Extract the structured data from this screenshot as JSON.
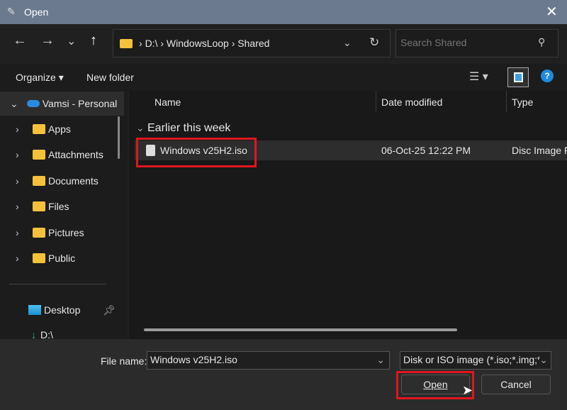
{
  "window": {
    "title": "Open",
    "close": "✕"
  },
  "nav": {
    "back": "←",
    "forward": "→",
    "recent": "⌄",
    "up": "↑"
  },
  "address": {
    "parts": [
      "D:\\",
      "WindowsLoop",
      "Shared"
    ]
  },
  "search": {
    "placeholder": "Search Shared"
  },
  "toolbar": {
    "organize": "Organize ▾",
    "new_folder": "New folder",
    "help": "?"
  },
  "sidebar": {
    "root": "Vamsi - Personal",
    "items": [
      {
        "label": "Apps"
      },
      {
        "label": "Attachments"
      },
      {
        "label": "Documents"
      },
      {
        "label": "Files"
      },
      {
        "label": "Pictures"
      },
      {
        "label": "Public"
      }
    ],
    "pinned": [
      {
        "label": "Desktop"
      },
      {
        "label": "D:\\"
      }
    ]
  },
  "columns": {
    "name": "Name",
    "date": "Date modified",
    "type": "Type"
  },
  "group": "Earlier this week",
  "files": [
    {
      "name": "Windows v25H2.iso",
      "date": "06-Oct-25 12:22 PM",
      "type": "Disc Image F"
    }
  ],
  "bottom": {
    "file_name_label": "File name:",
    "file_name": "Windows v25H2.iso",
    "filter": "Disk or ISO image (*.iso;*.img;*",
    "open": "Open",
    "cancel": "Cancel"
  }
}
